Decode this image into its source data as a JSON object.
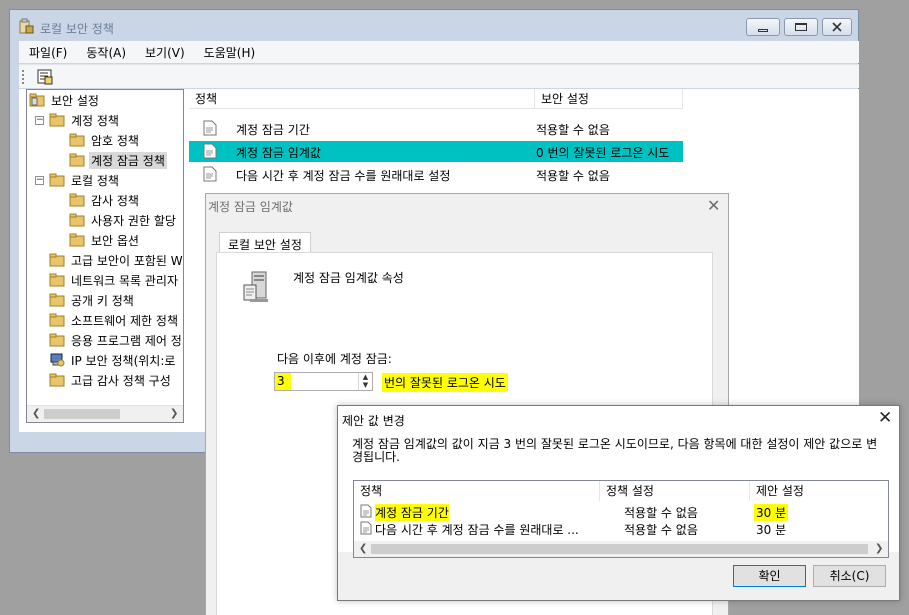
{
  "main_window": {
    "title": "로컬 보안 정책",
    "menu": [
      "파일(F)",
      "동작(A)",
      "보기(V)",
      "도움말(H)"
    ]
  },
  "tree": {
    "items": [
      {
        "label": "보안 설정",
        "level": 0,
        "expander": "",
        "icon": "shield-folder-icon"
      },
      {
        "label": "계정 정책",
        "level": 1,
        "expander": "−",
        "icon": "folder-icon"
      },
      {
        "label": "암호 정책",
        "level": 2,
        "expander": "",
        "icon": "folder-icon"
      },
      {
        "label": "계정 잠금 정책",
        "level": 2,
        "expander": "",
        "icon": "folder-icon",
        "selected": true
      },
      {
        "label": "로컬 정책",
        "level": 1,
        "expander": "−",
        "icon": "folder-icon"
      },
      {
        "label": "감사 정책",
        "level": 2,
        "expander": "",
        "icon": "folder-icon"
      },
      {
        "label": "사용자 권한 할당",
        "level": 2,
        "expander": "",
        "icon": "folder-icon"
      },
      {
        "label": "보안 옵션",
        "level": 2,
        "expander": "",
        "icon": "folder-icon"
      },
      {
        "label": "고급 보안이 포함된 W",
        "level": 1,
        "expander": "",
        "icon": "folder-icon"
      },
      {
        "label": "네트워크 목록 관리자",
        "level": 1,
        "expander": "",
        "icon": "folder-icon"
      },
      {
        "label": "공개 키 정책",
        "level": 1,
        "expander": "",
        "icon": "folder-icon"
      },
      {
        "label": "소프트웨어 제한 정책",
        "level": 1,
        "expander": "",
        "icon": "folder-icon"
      },
      {
        "label": "응용 프로그램 제어 정",
        "level": 1,
        "expander": "",
        "icon": "folder-icon"
      },
      {
        "label": "IP 보안 정책(위치:로",
        "level": 1,
        "expander": "",
        "icon": "ip-security-icon"
      },
      {
        "label": "고급 감사 정책 구성",
        "level": 1,
        "expander": "",
        "icon": "folder-icon"
      }
    ]
  },
  "policy_list": {
    "headers": [
      "정책",
      "보안 설정"
    ],
    "rows": [
      {
        "policy": "계정 잠금 기간",
        "setting": "적용할 수 없음"
      },
      {
        "policy": "계정 잠금 임계값",
        "setting": "0 번의 잘못된 로그온 시도",
        "selected": true
      },
      {
        "policy": "다음 시간 후 계정 잠금 수를 원래대로 설정",
        "setting": "적용할 수 없음"
      }
    ]
  },
  "property_dialog": {
    "title": "계정 잠금 임계값",
    "tab": "로컬 보안 설정",
    "heading": "계정 잠금 임계값 속성",
    "lockout_label": "다음 이후에 계정 잠금:",
    "value": "3",
    "suffix": "번의 잘못된 로그온 시도"
  },
  "change_dialog": {
    "title": "제안 값 변경",
    "message": "계정 잠금 임계값의 값이 지금 3 번의 잘못된 로그온 시도이므로, 다음 항목에 대한 설정이 제안 값으로 변경됩니다.",
    "headers": [
      "정책",
      "정책 설정",
      "제안 설정"
    ],
    "rows": [
      {
        "policy": "계정 잠금 기간",
        "setting": "적용할 수 없음",
        "suggested": "30 분"
      },
      {
        "policy": "다음 시간 후 계정 잠금 수를 원래대로 ...",
        "setting": "적용할 수 없음",
        "suggested": "30 분"
      }
    ],
    "ok": "확인",
    "cancel": "취소(C)"
  },
  "colors": {
    "selection": "#00c1c1",
    "highlight": "#ffff00",
    "window_frame": "#cad6e6"
  }
}
